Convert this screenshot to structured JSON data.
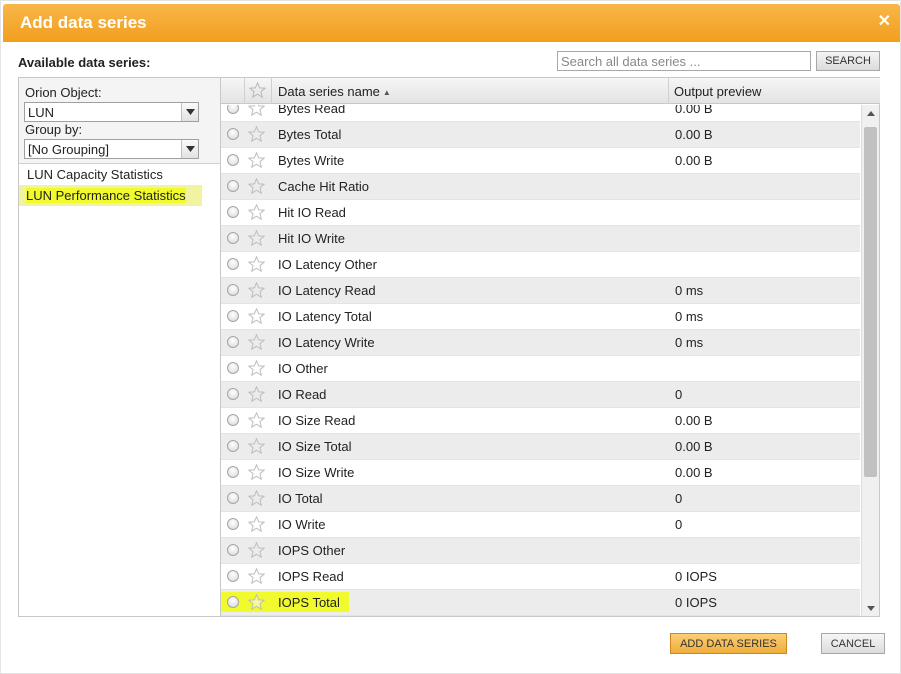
{
  "dialog": {
    "title": "Add data series",
    "close_icon": "close-icon"
  },
  "available_label": "Available data series:",
  "search": {
    "placeholder": "Search all data series ...",
    "button_label": "SEARCH"
  },
  "left_panel": {
    "orion_object_label": "Orion Object:",
    "orion_object_value": "LUN",
    "group_by_label": "Group by:",
    "group_by_value": "[No Grouping]",
    "items": [
      {
        "label": "LUN Capacity Statistics",
        "selected": false
      },
      {
        "label": "LUN Performance Statistics",
        "selected": true
      }
    ]
  },
  "grid": {
    "columns": {
      "name": "Data series name",
      "output": "Output preview"
    },
    "rows": [
      {
        "name": "Bytes Read",
        "output": "0.00 B"
      },
      {
        "name": "Bytes Total",
        "output": "0.00 B"
      },
      {
        "name": "Bytes Write",
        "output": "0.00 B"
      },
      {
        "name": "Cache Hit Ratio",
        "output": ""
      },
      {
        "name": "Hit IO Read",
        "output": ""
      },
      {
        "name": "Hit IO Write",
        "output": ""
      },
      {
        "name": "IO Latency Other",
        "output": ""
      },
      {
        "name": "IO Latency Read",
        "output": "0 ms"
      },
      {
        "name": "IO Latency Total",
        "output": "0 ms"
      },
      {
        "name": "IO Latency Write",
        "output": "0 ms"
      },
      {
        "name": "IO Other",
        "output": ""
      },
      {
        "name": "IO Read",
        "output": "0"
      },
      {
        "name": "IO Size Read",
        "output": "0.00 B"
      },
      {
        "name": "IO Size Total",
        "output": "0.00 B"
      },
      {
        "name": "IO Size Write",
        "output": "0.00 B"
      },
      {
        "name": "IO Total",
        "output": "0"
      },
      {
        "name": "IO Write",
        "output": "0"
      },
      {
        "name": "IOPS Other",
        "output": ""
      },
      {
        "name": "IOPS Read",
        "output": "0 IOPS"
      },
      {
        "name": "IOPS Total",
        "output": "0 IOPS",
        "highlighted": true
      }
    ]
  },
  "footer": {
    "add_label": "ADD DATA SERIES",
    "cancel_label": "CANCEL"
  },
  "colors": {
    "title_bar": "#f29f1c",
    "highlight": "#f0fa2c",
    "add_button": "#f0ad3b"
  }
}
